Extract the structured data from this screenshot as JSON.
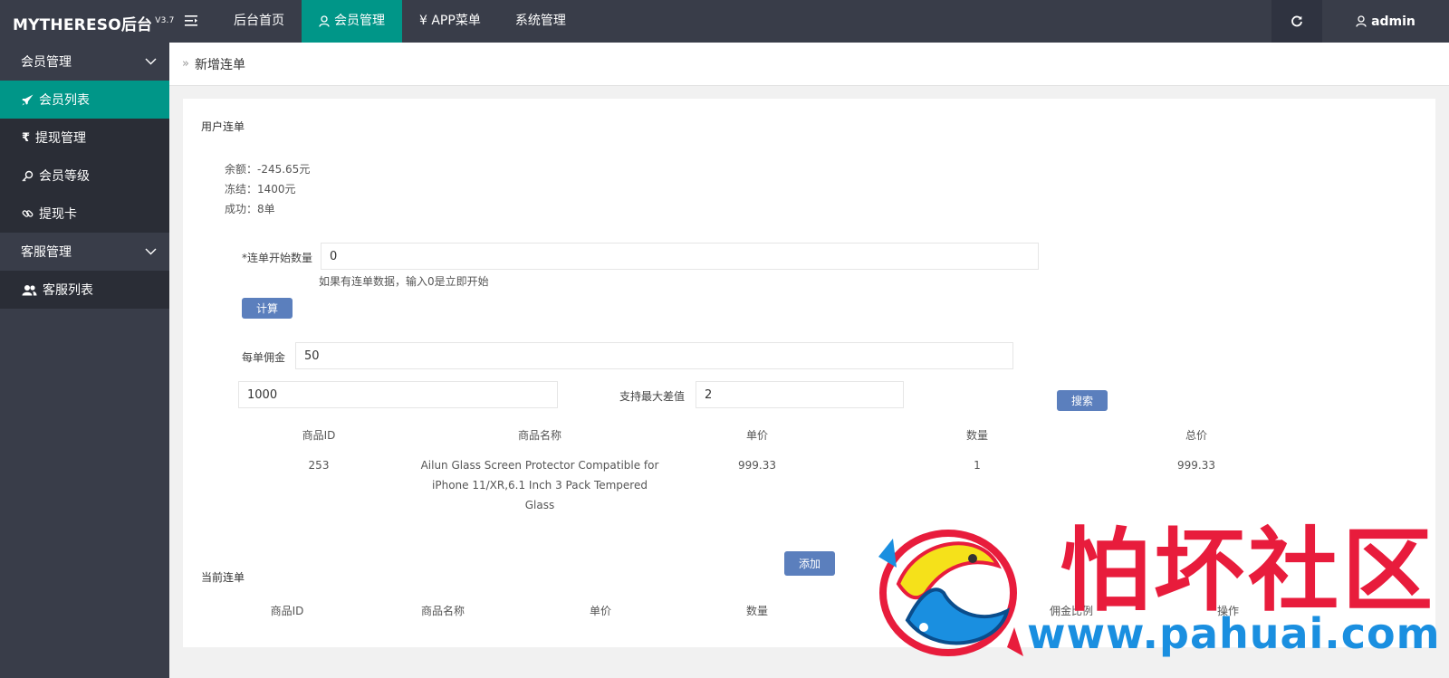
{
  "header": {
    "brand": "MYTHERESO后台",
    "version": "V3.7",
    "nav": [
      {
        "label": "后台首页"
      },
      {
        "label": "会员管理"
      },
      {
        "label": "¥ APP菜单"
      },
      {
        "label": "系统管理"
      }
    ],
    "user": "admin"
  },
  "sidebar": {
    "group1": "会员管理",
    "items1": [
      "会员列表",
      "提现管理",
      "会员等级",
      "提现卡"
    ],
    "group2": "客服管理",
    "items2": [
      "客服列表"
    ]
  },
  "breadcrumb": "新增连单",
  "main": {
    "section_title": "用户连单",
    "balance": "余额：-245.65元",
    "frozen": "冻结：1400元",
    "success": "成功：8单",
    "start_count_label": "*连单开始数量",
    "start_count_value": "0",
    "start_count_hint": "如果有连单数据，输入0是立即开始",
    "calc_button": "计算",
    "commission_label": "每单佣金",
    "commission_value": "50",
    "amount_value": "1000",
    "max_diff_label": "支持最大差值",
    "max_diff_value": "2",
    "search_button": "搜索",
    "table_headers": [
      "商品ID",
      "商品名称",
      "单价",
      "数量",
      "总价"
    ],
    "rows": [
      {
        "id": "253",
        "name_lines": [
          "Ailun Glass Screen Protector Compatible for",
          "iPhone 11/XR,6.1 Inch 3 Pack Tempered",
          "Glass"
        ],
        "price": "999.33",
        "qty": "1",
        "total": "999.33"
      }
    ],
    "add_button": "添加",
    "current_title": "当前连单",
    "current_headers": [
      "商品ID",
      "商品名称",
      "单价",
      "数量",
      "佣金比例",
      "操作"
    ]
  },
  "watermark": {
    "title": "怕坏社区",
    "url": "www.pahuai.com"
  },
  "colors": {
    "topbar": "#393d49",
    "accent": "#009688",
    "button": "#5b7fbd",
    "watermark_red": "#e81c3c",
    "watermark_blue": "#1a8fe0"
  }
}
